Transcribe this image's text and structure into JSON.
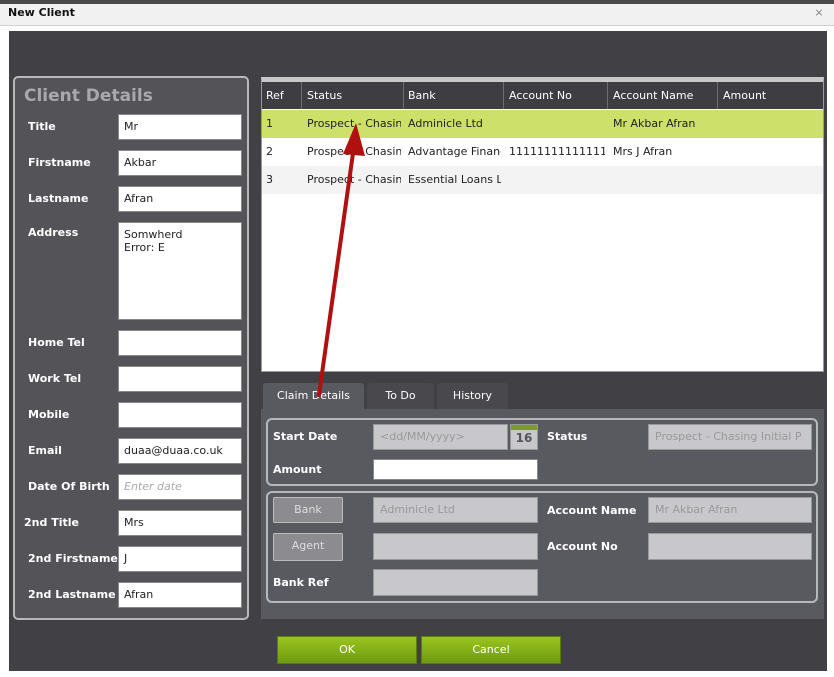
{
  "window": {
    "title": "New Client",
    "close_icon": "close-icon"
  },
  "client_details": {
    "header": "Client Details",
    "fields": {
      "title": {
        "label": "Title",
        "value": "Mr"
      },
      "firstname": {
        "label": "Firstname",
        "value": "Akbar"
      },
      "lastname": {
        "label": "Lastname",
        "value": "Afran"
      },
      "address": {
        "label": "Address",
        "value": "Somwherd\nError: E"
      },
      "home_tel": {
        "label": "Home Tel",
        "value": ""
      },
      "work_tel": {
        "label": "Work Tel",
        "value": ""
      },
      "mobile": {
        "label": "Mobile",
        "value": ""
      },
      "email": {
        "label": "Email",
        "value": "duaa@duaa.co.uk"
      },
      "dob": {
        "label": "Date Of Birth",
        "value": "",
        "placeholder": "Enter date"
      },
      "title2": {
        "label": "2nd Title",
        "value": "Mrs"
      },
      "firstname2": {
        "label": "2nd Firstname",
        "value": "J"
      },
      "lastname2": {
        "label": "2nd Lastname",
        "value": "Afran"
      }
    }
  },
  "grid": {
    "columns": [
      "Ref",
      "Status",
      "Bank",
      "Account No",
      "Account Name",
      "Amount"
    ],
    "rows": [
      {
        "ref": "1",
        "status": "Prospect - Chasing Initial Pack",
        "bank": "Adminicle Ltd",
        "account_no": "",
        "account_name": "Mr Akbar Afran",
        "amount": ""
      },
      {
        "ref": "2",
        "status": "Prospect - Chasing Initial Pack",
        "bank": "Advantage Finance",
        "account_no": "11111111111111",
        "account_name": "Mrs J Afran",
        "amount": ""
      },
      {
        "ref": "3",
        "status": "Prospect - Chasing Initial Pack",
        "bank": "Essential Loans Ltd",
        "account_no": "",
        "account_name": "",
        "amount": ""
      }
    ],
    "selected_row": 1,
    "selected_color": "#cde06a"
  },
  "tabs": {
    "items": [
      "Claim Details",
      "To Do",
      "History"
    ],
    "active": "Claim Details"
  },
  "claim": {
    "start_date_label": "Start Date",
    "start_date_placeholder": "<dd/MM/yyyy>",
    "calendar_day": "16",
    "status_label": "Status",
    "status_value": "Prospect - Chasing Initial P",
    "amount_label": "Amount",
    "amount_value": "",
    "bank_button": "Bank",
    "bank_value": "Adminicle Ltd",
    "account_name_label": "Account Name",
    "account_name_value": "Mr Akbar Afran",
    "agent_button": "Agent",
    "agent_value": "",
    "account_no_label": "Account No",
    "account_no_value": "",
    "bank_ref_label": "Bank Ref",
    "bank_ref_value": ""
  },
  "footer": {
    "ok_label": "OK",
    "cancel_label": "Cancel"
  },
  "colors": {
    "accent_green": "#8cb81a",
    "annotation_arrow": "#b01010"
  }
}
